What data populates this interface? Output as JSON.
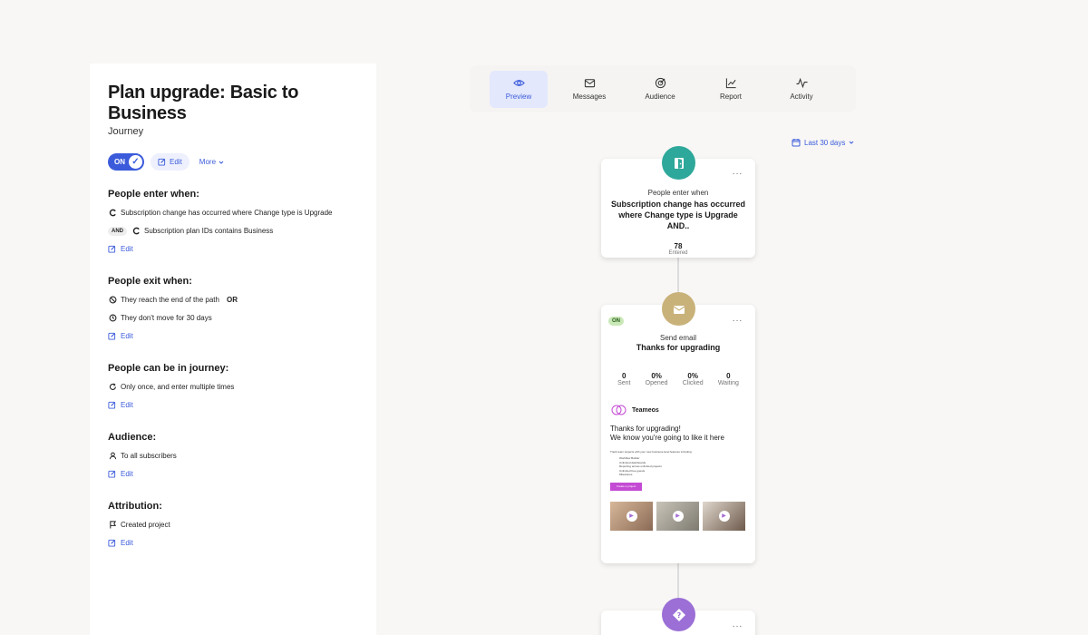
{
  "journey": {
    "title": "Plan upgrade: Basic to Business",
    "subtitle": "Journey",
    "toggle_label": "ON",
    "edit_label": "Edit",
    "more_label": "More"
  },
  "sections": {
    "enter": {
      "title": "People enter when:",
      "condition1": "Subscription change has occurred where Change type is Upgrade",
      "and_label": "AND",
      "condition2": "Subscription plan IDs contains Business",
      "edit": "Edit"
    },
    "exit": {
      "title": "People exit when:",
      "condition1": "They reach the end of the path",
      "or_label": "OR",
      "condition2": "They don't move for 30 days",
      "edit": "Edit"
    },
    "frequency": {
      "title": "People can be in journey:",
      "condition1": "Only once, and enter multiple times",
      "edit": "Edit"
    },
    "audience": {
      "title": "Audience:",
      "condition1": "To all subscribers",
      "edit": "Edit"
    },
    "attribution": {
      "title": "Attribution:",
      "condition1": "Created project",
      "edit": "Edit"
    }
  },
  "tabs": [
    {
      "label": "Preview",
      "icon": "eye-icon"
    },
    {
      "label": "Messages",
      "icon": "envelope-icon"
    },
    {
      "label": "Audience",
      "icon": "target-icon"
    },
    {
      "label": "Report",
      "icon": "chart-icon"
    },
    {
      "label": "Activity",
      "icon": "pulse-icon"
    }
  ],
  "date_range": "Last 30 days",
  "entry_node": {
    "label": "People enter when",
    "condition": "Subscription change has occurred where Change type is Upgrade AND..",
    "count": "78",
    "count_label": "Entered",
    "color": "#2ea89a"
  },
  "email_node": {
    "status": "ON",
    "label": "Send email",
    "name": "Thanks for upgrading",
    "color": "#c9b27a",
    "stats": [
      {
        "value": "0",
        "label": "Sent"
      },
      {
        "value": "0%",
        "label": "Opened"
      },
      {
        "value": "0%",
        "label": "Clicked"
      },
      {
        "value": "0",
        "label": "Waiting"
      }
    ],
    "preview": {
      "brand": "Teameos",
      "headline1": "Thanks for upgrading!",
      "headline2": "We know you're going to like it here",
      "body": "Track team projects with your new business-level features including:",
      "bullets": [
        "Workflow Builder",
        "Unlimited dashboards",
        "Reporting across unlimited projects",
        "Unlimited free guests",
        "Milestones"
      ],
      "cta": "Create a project"
    }
  },
  "condition_node": {
    "color": "#9b6fd6"
  }
}
